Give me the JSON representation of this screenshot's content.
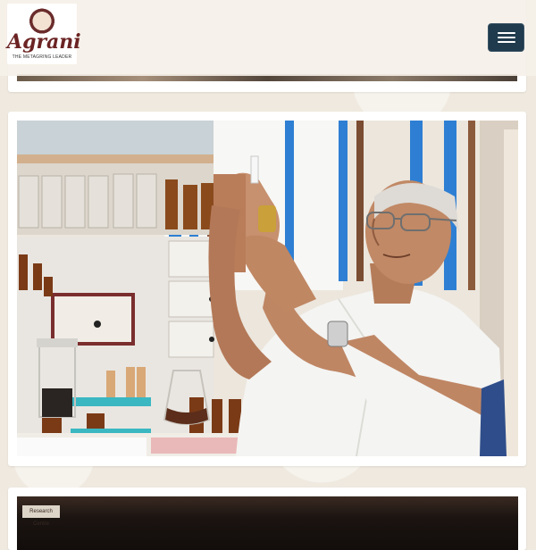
{
  "header": {
    "logo": {
      "name": "Agrani",
      "tagline": "THE METAGRING LEADER"
    },
    "menu_toggle_icon": "hamburger-icon"
  },
  "gallery": {
    "items": [
      {
        "kind": "photo",
        "subject": "cropped-photo-top"
      },
      {
        "kind": "photo",
        "subject": "elderly-doctor-examining-vial-in-homeopathy-pharmacy"
      },
      {
        "kind": "photo",
        "subject": "dark-interior-photo",
        "sign_text": "Research Centre"
      }
    ]
  },
  "colors": {
    "menu_button": "#1f3b4d",
    "logo_red": "#6b2323",
    "background": "#efe9df",
    "card": "#ffffff"
  }
}
